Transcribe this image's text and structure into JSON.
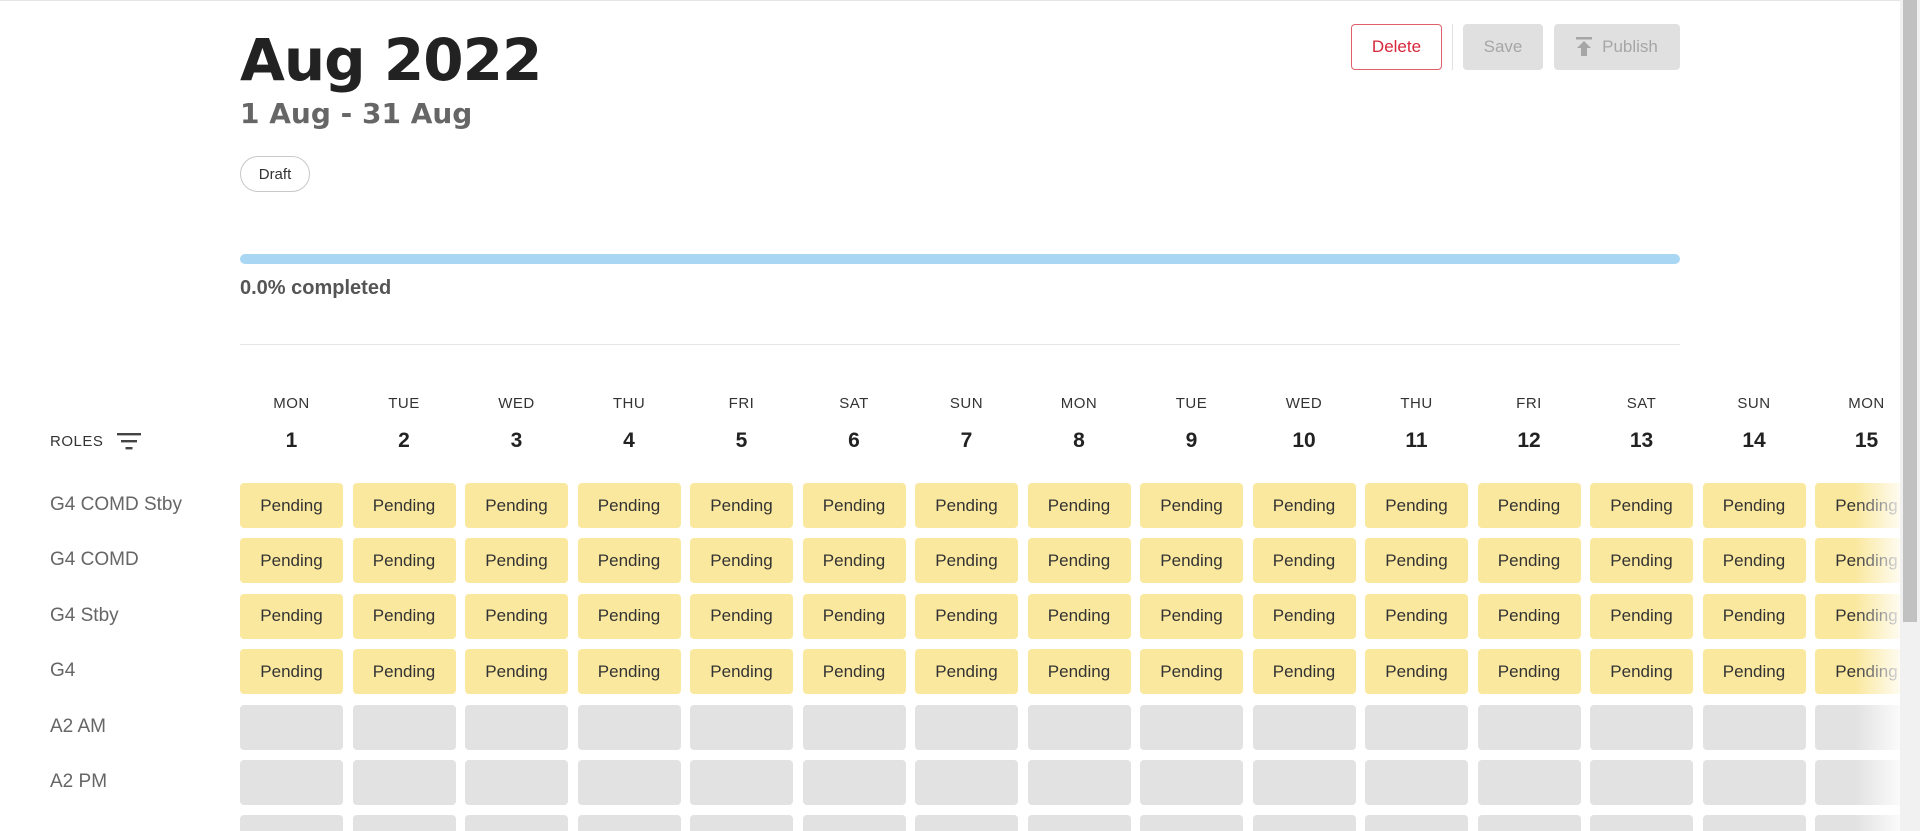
{
  "header": {
    "title": "Aug 2022",
    "date_range": "1 Aug - 31 Aug",
    "status": "Draft"
  },
  "actions": {
    "delete_label": "Delete",
    "save_label": "Save",
    "publish_label": "Publish"
  },
  "progress": {
    "fraction": 0.0,
    "label": "0.0% completed"
  },
  "colors": {
    "pending": "#fae89e",
    "empty": "#e2e2e2",
    "delete": "#d8263a",
    "progress_track": "#a9d6f2"
  },
  "schedule": {
    "roles_header": "ROLES",
    "days": [
      {
        "name": "MON",
        "num": "1"
      },
      {
        "name": "TUE",
        "num": "2"
      },
      {
        "name": "WED",
        "num": "3"
      },
      {
        "name": "THU",
        "num": "4"
      },
      {
        "name": "FRI",
        "num": "5"
      },
      {
        "name": "SAT",
        "num": "6"
      },
      {
        "name": "SUN",
        "num": "7"
      },
      {
        "name": "MON",
        "num": "8"
      },
      {
        "name": "TUE",
        "num": "9"
      },
      {
        "name": "WED",
        "num": "10"
      },
      {
        "name": "THU",
        "num": "11"
      },
      {
        "name": "FRI",
        "num": "12"
      },
      {
        "name": "SAT",
        "num": "13"
      },
      {
        "name": "SUN",
        "num": "14"
      },
      {
        "name": "MON",
        "num": "15"
      }
    ],
    "roles": [
      {
        "name": "G4 COMD Stby",
        "state": "pending"
      },
      {
        "name": "G4 COMD",
        "state": "pending"
      },
      {
        "name": "G4 Stby",
        "state": "pending"
      },
      {
        "name": "G4",
        "state": "pending"
      },
      {
        "name": "A2 AM",
        "state": "empty"
      },
      {
        "name": "A2 PM",
        "state": "empty"
      },
      {
        "name": "",
        "state": "empty"
      }
    ],
    "pending_label": "Pending"
  }
}
